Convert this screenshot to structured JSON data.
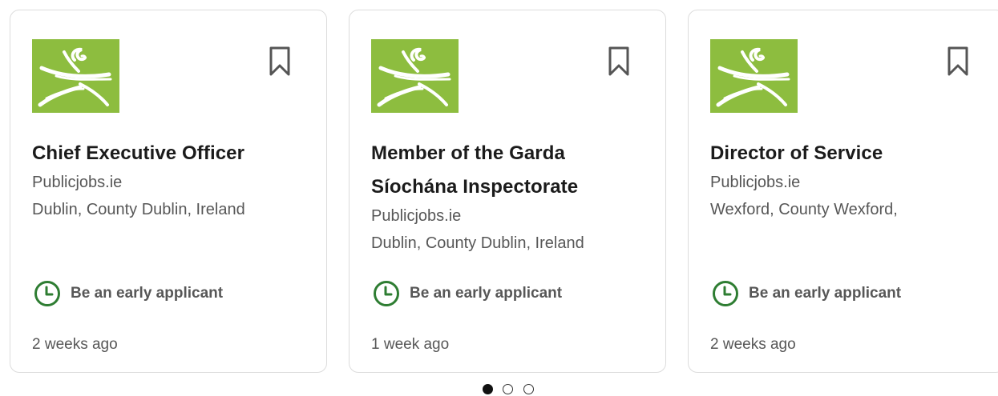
{
  "brand_colors": {
    "logo_green": "#8dbd3f",
    "early_icon_green": "#2e7d32",
    "text_primary": "#1b1b1b",
    "text_secondary": "#575757"
  },
  "cards": [
    {
      "title": "Chief Executive Officer",
      "company": "Publicjobs.ie",
      "location": "Dublin, County Dublin, Ireland",
      "insight": "Be an early applicant",
      "insight_icon": "clock-icon",
      "posted": "2 weeks ago",
      "save_icon": "bookmark-icon"
    },
    {
      "title": "Member of the Garda Síochána Inspectorate",
      "company": "Publicjobs.ie",
      "location": "Dublin, County Dublin, Ireland",
      "insight": "Be an early applicant",
      "insight_icon": "clock-icon",
      "posted": "1 week ago",
      "save_icon": "bookmark-icon"
    },
    {
      "title": "Director of Service",
      "company": "Publicjobs.ie",
      "location": "Wexford, County Wexford,",
      "insight": "Be an early applicant",
      "insight_icon": "clock-icon",
      "posted": "2 weeks ago",
      "save_icon": "bookmark-icon"
    }
  ],
  "pagination": {
    "total_pages": 3,
    "active_page": 1
  }
}
